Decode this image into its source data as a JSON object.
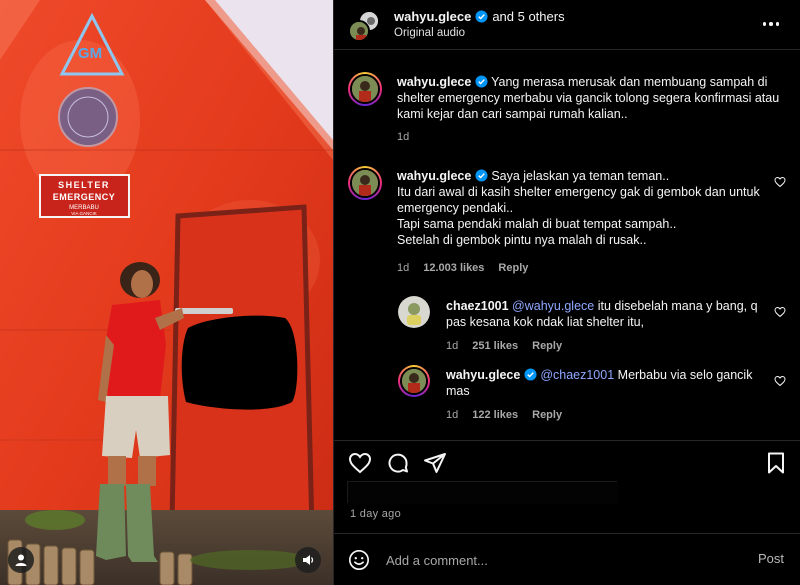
{
  "post": {
    "author": "wahyu.glece",
    "coauthors": "and 5 others",
    "audio": "Original audio",
    "time_ago": "1 day ago"
  },
  "media": {
    "sign_logo": "GM",
    "sign_title_1": "SHELTER",
    "sign_title_2": "EMERGENCY",
    "sign_sub_1": "MERBABU",
    "sign_sub_2": "VIA GANCIK",
    "wall_color": "#e8351c",
    "door_color": "#e23a1c",
    "sky_color": "#ebe4ee"
  },
  "comments": [
    {
      "user": "wahyu.glece",
      "verified": true,
      "text": "Yang merasa merusak dan membuang sampah di shelter emergency merbabu via gancik tolong segera konfirmasi atau kami kejar dan cari sampai rumah kalian..",
      "time": "1d"
    },
    {
      "user": "wahyu.glece",
      "verified": true,
      "lines": [
        "Saya jelaskan ya teman teman..",
        "Itu dari awal di kasih shelter emergency gak di gembok dan untuk emergency pendaki..",
        "Tapi sama pendaki malah di buat tempat sampah..",
        "Setelah di gembok pintu nya malah di rusak.."
      ],
      "time": "1d",
      "likes": "12.003 likes",
      "reply": "Reply"
    }
  ],
  "replies": [
    {
      "user": "chaez1001",
      "mention": "@wahyu.glece",
      "text": "itu disebelah mana y bang, q pas kesana kok ndak liat shelter itu,",
      "time": "1d",
      "likes": "251 likes",
      "reply": "Reply"
    },
    {
      "user": "wahyu.glece",
      "verified": true,
      "mention": "@chaez1001",
      "text": "Merbabu via selo gancik mas",
      "time": "1d",
      "likes": "122 likes",
      "reply": "Reply"
    }
  ],
  "composer": {
    "placeholder": "Add a comment...",
    "post_label": "Post"
  },
  "colors": {
    "verified": "#0095f6",
    "mention": "#8fa8ff",
    "muted_text": "#a8a8a8"
  },
  "icons": [
    "heart-icon",
    "comment-icon",
    "share-icon",
    "bookmark-icon",
    "emoji-icon",
    "more-options-icon",
    "tag-users-icon",
    "mute-icon"
  ]
}
